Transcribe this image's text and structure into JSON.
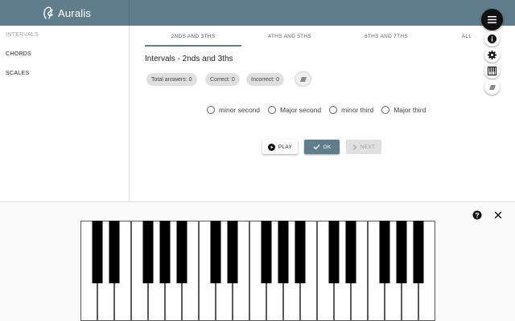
{
  "app": {
    "title": "Auralis"
  },
  "sidebar": {
    "items": [
      {
        "label": "INTERVALS",
        "active": true
      },
      {
        "label": "CHORDS",
        "active": false
      },
      {
        "label": "SCALES",
        "active": false
      }
    ]
  },
  "tabs": [
    {
      "label": "2NDS AND 3THS",
      "active": true
    },
    {
      "label": "4THS AND 5THS",
      "active": false
    },
    {
      "label": "6THS AND 7THS",
      "active": false
    },
    {
      "label": "ALL",
      "active": false
    }
  ],
  "main": {
    "title": "Intervals - 2nds and 3ths",
    "stats": {
      "total": "Total answers: 0",
      "correct": "Correct: 0",
      "incorrect": "Incorrect: 0"
    },
    "options": [
      {
        "label": "minor second"
      },
      {
        "label": "Major second"
      },
      {
        "label": "minor third"
      },
      {
        "label": "Major third"
      }
    ],
    "buttons": {
      "play": "PLAY",
      "ok": "OK",
      "next": "NEXT"
    }
  },
  "colors": {
    "primary": "#607d8b",
    "fab": "#111111",
    "chip": "#e0e0e0"
  },
  "icons": {
    "brand": "auralis-logo-icon",
    "menu": "menu-icon",
    "info": "info-icon",
    "settings": "gear-icon",
    "piano": "piano-icon",
    "eraser": "eraser-icon",
    "help": "help-icon",
    "close": "close-icon"
  }
}
